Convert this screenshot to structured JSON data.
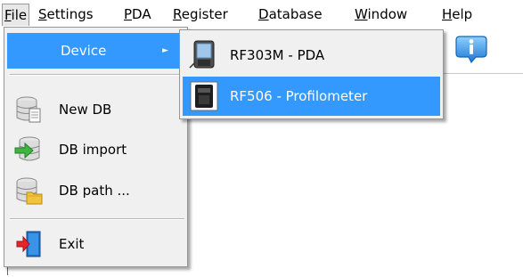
{
  "menubar": {
    "items": [
      {
        "label": "File",
        "accel": "F",
        "rest": "ile"
      },
      {
        "label": "Settings",
        "accel": "S",
        "rest": "ettings"
      },
      {
        "label": "PDA",
        "accel": "P",
        "rest": "DA"
      },
      {
        "label": "Register",
        "accel": "R",
        "rest": "egister"
      },
      {
        "label": "Database",
        "accel": "D",
        "rest": "atabase"
      },
      {
        "label": "Window",
        "accel": "W",
        "rest": "indow"
      },
      {
        "label": "Help",
        "accel": "H",
        "rest": "elp"
      }
    ]
  },
  "file_menu": {
    "device_label": "Device",
    "submenu_arrow": "►",
    "new_db_label": "New DB",
    "db_import_label": "DB import",
    "db_path_label": "DB path ...",
    "exit_label": "Exit"
  },
  "device_submenu": {
    "items": [
      {
        "label": "RF303M - PDA",
        "icon": "pda-icon"
      },
      {
        "label": "RF506 - Profilometer",
        "icon": "profilometer-icon"
      }
    ]
  },
  "toolbar": {
    "info_icon": "info-icon"
  },
  "colors": {
    "highlight": "#3399ff",
    "menu_bg": "#f0f0f0",
    "menu_border": "#979797"
  }
}
